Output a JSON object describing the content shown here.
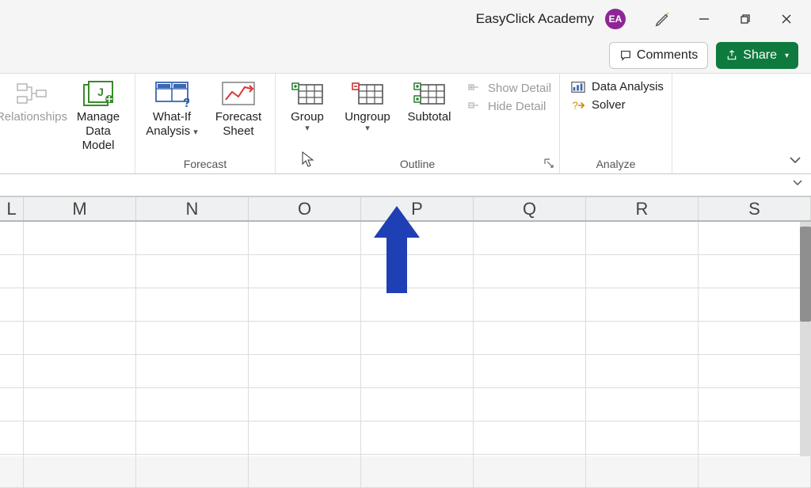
{
  "titlebar": {
    "doc_title": "EasyClick Academy",
    "avatar_initials": "EA"
  },
  "actions": {
    "comments": "Comments",
    "share": "Share"
  },
  "ribbon": {
    "relationships": {
      "label": "Relationships"
    },
    "manage_data_model": {
      "label_line1": "Manage",
      "label_line2": "Data Model"
    },
    "forecast_group_label": "Forecast",
    "whatif": {
      "label_line1": "What-If",
      "label_line2": "Analysis"
    },
    "forecast_sheet": {
      "label_line1": "Forecast",
      "label_line2": "Sheet"
    },
    "outline_group_label": "Outline",
    "group": {
      "label": "Group"
    },
    "ungroup": {
      "label": "Ungroup"
    },
    "subtotal": {
      "label": "Subtotal"
    },
    "show_detail": "Show Detail",
    "hide_detail": "Hide Detail",
    "analyze_group_label": "Analyze",
    "data_analysis": "Data Analysis",
    "solver": "Solver"
  },
  "columns": [
    "L",
    "M",
    "N",
    "O",
    "P",
    "Q",
    "R",
    "S"
  ]
}
